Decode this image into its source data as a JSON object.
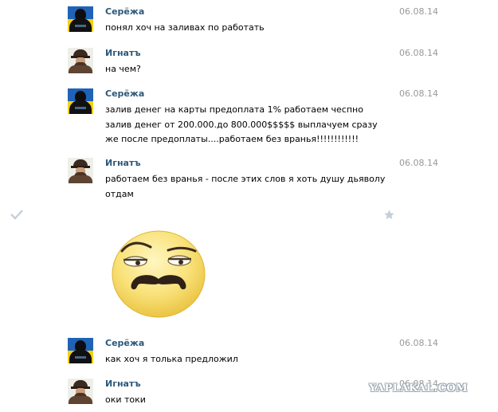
{
  "messages": [
    {
      "author": "Серёжа",
      "date": "06.08.14",
      "text": "понял хоч на заливах по работать"
    },
    {
      "author": "Игнатъ",
      "date": "06.08.14",
      "text": "на чем?"
    },
    {
      "author": "Серёжа",
      "date": "06.08.14",
      "text": "залив денег на карты предоплата 1% работаем чеспно\nзалив денег от 200.000.до 800.000$$$$$ выплачуем сразу\nже после предоплаты....работаем без вранья!!!!!!!!!!!!"
    },
    {
      "author": "Игнатъ",
      "date": "06.08.14",
      "text": "работаем без вранья - после этих слов я хоть душу дьяволу\nотдам"
    },
    {
      "author": "Серёжа",
      "date": "06.08.14",
      "text": "как хоч я толька предложил"
    },
    {
      "author": "Игнатъ",
      "date": "06.08.14",
      "text": "оки токи"
    }
  ],
  "icons": {
    "check": "check-icon",
    "star": "star-icon",
    "sticker": "mustache-smiley-sticker"
  },
  "colors": {
    "author": "#2b587a",
    "date": "#999999",
    "side_icon": "#c5cfd9",
    "sticker_face": "#f9e27a"
  },
  "watermark": "YAPLAKAL.COM"
}
